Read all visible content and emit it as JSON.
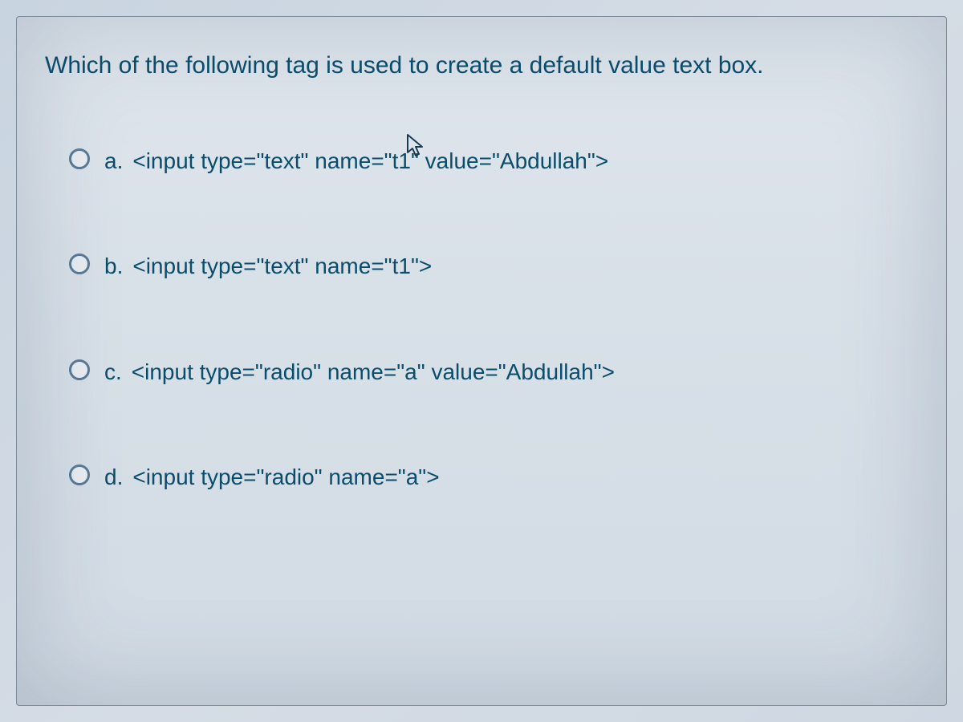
{
  "question": {
    "prompt": "Which of the following tag is used to create a default value text box."
  },
  "options": [
    {
      "label": "a.",
      "text": "<input type=\"text\" name=\"t1\" value=\"Abdullah\">"
    },
    {
      "label": "b.",
      "text": "<input type=\"text\" name=\"t1\">"
    },
    {
      "label": "c.",
      "text": "<input type=\"radio\" name=\"a\" value=\"Abdullah\">"
    },
    {
      "label": "d.",
      "text": "<input type=\"radio\" name=\"a\">"
    }
  ]
}
